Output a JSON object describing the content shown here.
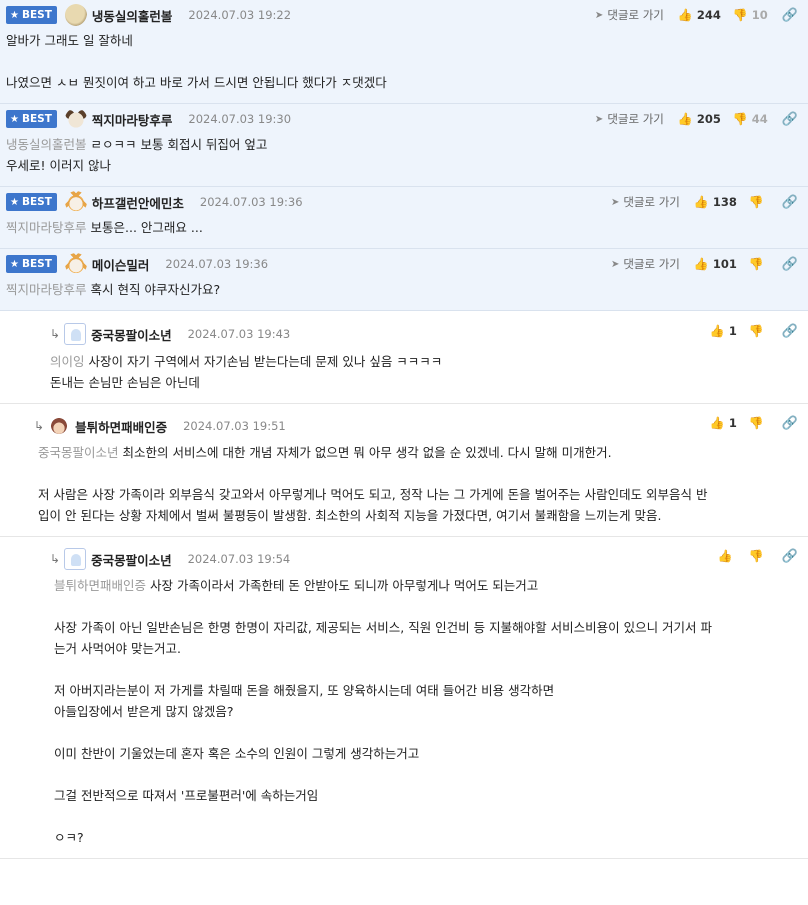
{
  "labels": {
    "best": "BEST",
    "goto": "댓글로 가기"
  },
  "colors": {
    "best_bg": "#eef4fc",
    "badge": "#3d76cc"
  },
  "comments": [
    {
      "nick": "냉동실의홀런볼",
      "date": "2024.07.03 19:22",
      "up": "244",
      "down": "10",
      "lines": [
        "알바가 그래도 일 잘하네",
        "",
        "나였으면 ㅅㅂ 뭔짓이여 하고 바로 가서 드시면 안됩니다 했다가 ㅈ댓겠다"
      ]
    },
    {
      "nick": "찍지마라탕후루",
      "date": "2024.07.03 19:30",
      "up": "205",
      "down": "44",
      "mention": "냉동실의홀런볼",
      "lines": [
        "ㄹㅇㅋㅋ 보통 회접시 뒤집어 엎고",
        "우세로! 이러지 않나"
      ]
    },
    {
      "nick": "하프갤런안에민초",
      "date": "2024.07.03 19:36",
      "up": "138",
      "mention": "찍지마라탕후루",
      "lines": [
        "보통은... 안그래요 ..."
      ]
    },
    {
      "nick": "메이슨밀러",
      "date": "2024.07.03 19:36",
      "up": "101",
      "mention": "찍지마라탕후루",
      "lines": [
        "혹시 현직 야쿠자신가요?"
      ]
    },
    {
      "nick": "중국몽팔이소년",
      "date": "2024.07.03 19:43",
      "up": "1",
      "mention": "의이잉",
      "lines": [
        "사장이 자기 구역에서 자기손님 받는다는데 문제 있나 싶음 ㅋㅋㅋㅋ",
        "돈내는 손님만 손님은 아닌데"
      ]
    },
    {
      "nick": "블튀하면패배인증",
      "date": "2024.07.03 19:51",
      "up": "1",
      "mention": "중국몽팔이소년",
      "lines": [
        "최소한의 서비스에 대한 개념 자체가 없으면 뭐 아무 생각 없을 순 있겠네. 다시 말해 미개한거.",
        "",
        "저 사람은 사장 가족이라 외부음식 갖고와서 아무렇게나 먹어도 되고, 정작 나는 그 가게에 돈을 벌어주는 사람인데도 외부음식 반",
        "입이 안 된다는 상황 자체에서 벌써 불평등이 발생함. 최소한의 사회적 지능을 가졌다면, 여기서 불쾌함을 느끼는게 맞음."
      ]
    },
    {
      "nick": "중국몽팔이소년",
      "date": "2024.07.03 19:54",
      "mention": "블튀하면패배인증",
      "lines": [
        "사장 가족이라서 가족한테 돈 안받아도 되니까 아무렇게나 먹어도 되는거고",
        "",
        "사장 가족이 아닌 일반손님은 한명 한명이 자리값, 제공되는 서비스, 직원 인건비 등 지불해야할 서비스비용이 있으니 거기서 파",
        "는거 사먹어야 맞는거고.",
        "",
        "저 아버지라는분이 저 가게를 차릴때 돈을 해줬을지, 또 양육하시는데 여태 들어간 비용 생각하면",
        "아들입장에서 받은게 많지 않겠음?",
        "",
        "이미 찬반이 기울었는데 혼자 혹은 소수의 인원이 그렇게 생각하는거고",
        "",
        "그걸 전반적으로 따져서 '프로불편러'에 속하는거임",
        "",
        "ㅇㅋ?"
      ]
    }
  ]
}
